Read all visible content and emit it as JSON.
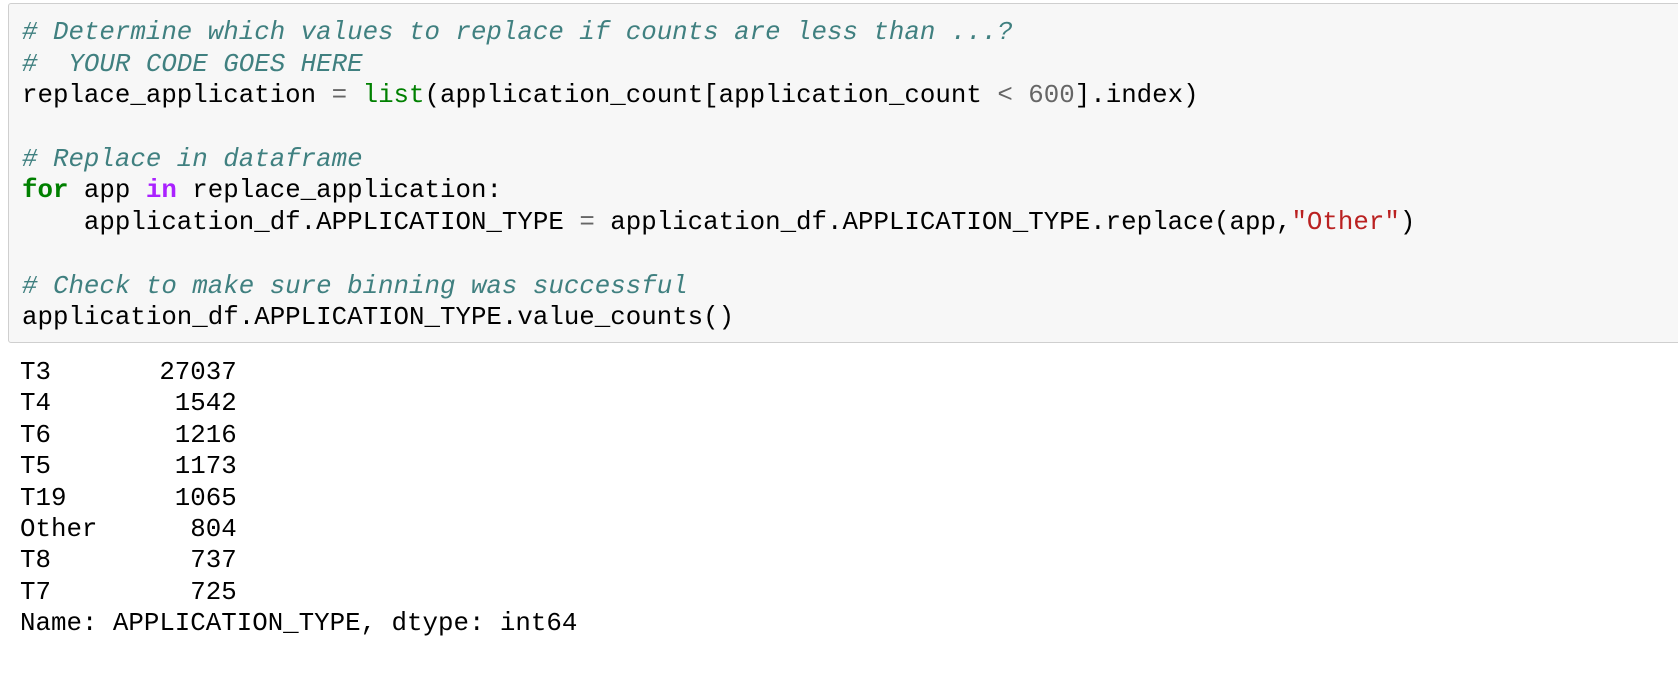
{
  "code_cell": {
    "lines": [
      [
        {
          "t": "# Determine which values to replace if counts are less than ...?",
          "c": "cm"
        }
      ],
      [
        {
          "t": "#  YOUR CODE GOES HERE",
          "c": "cm"
        }
      ],
      [
        {
          "t": "replace_application ",
          "c": "tx"
        },
        {
          "t": "=",
          "c": "op"
        },
        {
          "t": " ",
          "c": "tx"
        },
        {
          "t": "list",
          "c": "bi"
        },
        {
          "t": "(application_count[application_count ",
          "c": "tx"
        },
        {
          "t": "<",
          "c": "op"
        },
        {
          "t": " ",
          "c": "tx"
        },
        {
          "t": "600",
          "c": "nu"
        },
        {
          "t": "].index)",
          "c": "tx"
        }
      ],
      [],
      [
        {
          "t": "# Replace in dataframe",
          "c": "cm"
        }
      ],
      [
        {
          "t": "for",
          "c": "kw"
        },
        {
          "t": " app ",
          "c": "tx"
        },
        {
          "t": "in",
          "c": "ow"
        },
        {
          "t": " replace_application:",
          "c": "tx"
        }
      ],
      [
        {
          "t": "    application_df.APPLICATION_TYPE ",
          "c": "tx"
        },
        {
          "t": "=",
          "c": "op"
        },
        {
          "t": " application_df.APPLICATION_TYPE.replace(app,",
          "c": "tx"
        },
        {
          "t": "\"Other\"",
          "c": "st"
        },
        {
          "t": ")",
          "c": "tx"
        }
      ],
      [],
      [
        {
          "t": "# Check to make sure binning was successful",
          "c": "cm"
        }
      ],
      [
        {
          "t": "application_df.APPLICATION_TYPE.value_counts()",
          "c": "tx"
        }
      ]
    ]
  },
  "output": {
    "rows": [
      {
        "label": "T3",
        "value": "27037"
      },
      {
        "label": "T4",
        "value": "1542"
      },
      {
        "label": "T6",
        "value": "1216"
      },
      {
        "label": "T5",
        "value": "1173"
      },
      {
        "label": "T19",
        "value": "1065"
      },
      {
        "label": "Other",
        "value": "804"
      },
      {
        "label": "T8",
        "value": "737"
      },
      {
        "label": "T7",
        "value": "725"
      }
    ],
    "footer": "Name: APPLICATION_TYPE, dtype: int64"
  },
  "colors": {
    "comment": "#408080",
    "keyword": "#008000",
    "operator_word": "#AA22FF",
    "string": "#BA2121",
    "number": "#666666",
    "cell_bg": "#f7f7f7",
    "cell_border": "#cfcfcf"
  }
}
